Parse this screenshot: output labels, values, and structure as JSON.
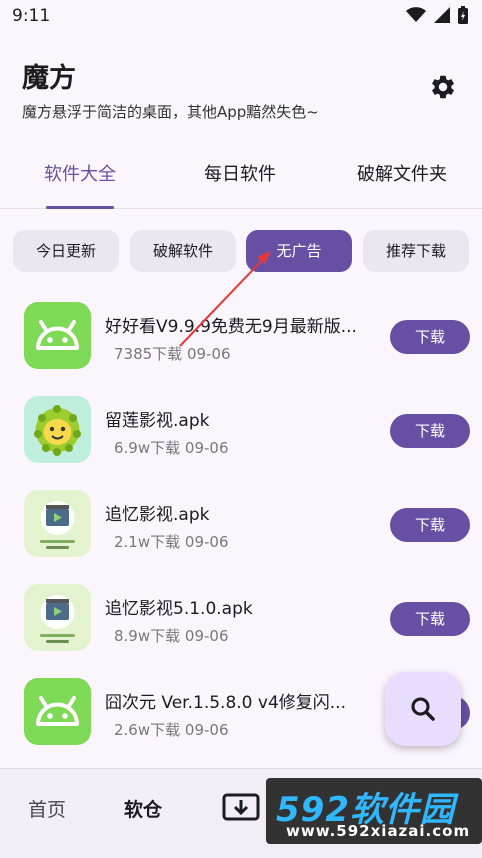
{
  "status_bar": {
    "time": "9:11"
  },
  "header": {
    "title": "魔方",
    "subtitle": "魔方悬浮于简洁的桌面，其他App黯然失色~"
  },
  "tabs": [
    {
      "label": "软件大全",
      "active": true
    },
    {
      "label": "每日软件",
      "active": false
    },
    {
      "label": "破解文件夹",
      "active": false
    }
  ],
  "chips": [
    {
      "label": "今日更新",
      "selected": false
    },
    {
      "label": "破解软件",
      "selected": false
    },
    {
      "label": "无广告",
      "selected": true
    },
    {
      "label": "推荐下载",
      "selected": false
    }
  ],
  "apps": [
    {
      "name": "好好看V9.9.9免费无9月最新版...",
      "downloads": "7385下载",
      "date": "09-06",
      "button": "下载",
      "icon": "android-icon"
    },
    {
      "name": "留莲影视.apk",
      "downloads": "6.9w下载",
      "date": "09-06",
      "button": "下载",
      "icon": "durian-icon"
    },
    {
      "name": "追忆影视.apk",
      "downloads": "2.1w下载",
      "date": "09-06",
      "button": "下载",
      "icon": "film-icon"
    },
    {
      "name": "追忆影视5.1.0.apk",
      "downloads": "8.9w下载",
      "date": "09-06",
      "button": "下载",
      "icon": "film-icon"
    },
    {
      "name": "囧次元 Ver.1.5.8.0  v4修复闪...",
      "downloads": "2.6w下载",
      "date": "09-06",
      "button": "",
      "icon": "android-icon"
    }
  ],
  "bottom_nav": {
    "home": "首页",
    "software": "软仓"
  },
  "watermark": {
    "big": "592软件园",
    "small": "www.592xiazai.com"
  },
  "colors": {
    "primary": "#6750a4",
    "chip": "#ece6f0",
    "background": "#fbf6fd",
    "android_green": "#7ed957",
    "arrow": "#e53935"
  }
}
